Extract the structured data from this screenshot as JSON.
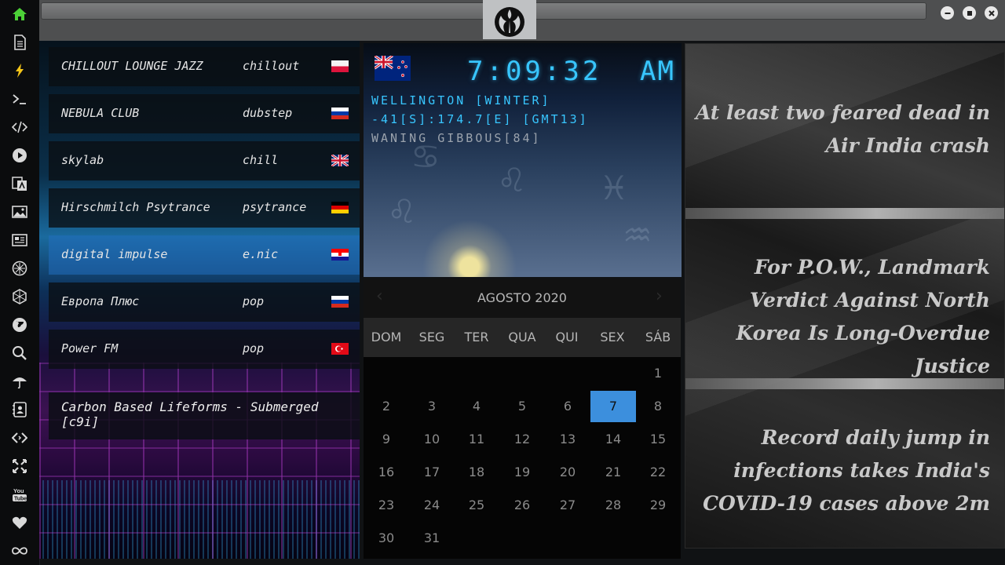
{
  "sidebar": {
    "items": [
      {
        "icon": "home-icon",
        "color": "#4cd137"
      },
      {
        "icon": "document-icon"
      },
      {
        "icon": "lightning-icon",
        "color": "#f5c518"
      },
      {
        "icon": "terminal-icon"
      },
      {
        "icon": "code-icon"
      },
      {
        "icon": "play-icon"
      },
      {
        "icon": "translate-icon"
      },
      {
        "icon": "image-icon"
      },
      {
        "icon": "news-icon"
      },
      {
        "icon": "compass-icon"
      },
      {
        "icon": "hexagon-icon"
      },
      {
        "icon": "globe-icon"
      },
      {
        "icon": "search-icon"
      },
      {
        "icon": "umbrella-icon"
      },
      {
        "icon": "contacts-icon"
      },
      {
        "icon": "code-brackets-icon"
      },
      {
        "icon": "expand-icon"
      },
      {
        "icon": "youtube-icon"
      },
      {
        "icon": "heart-icon"
      },
      {
        "icon": "infinity-icon"
      }
    ]
  },
  "titlebar": {
    "emblem": "rebel-alliance-icon"
  },
  "radio": {
    "stations": [
      {
        "name": "CHILLOUT LOUNGE JAZZ",
        "genre": "chillout",
        "flag": "poland"
      },
      {
        "name": "NEBULA CLUB",
        "genre": "dubstep",
        "flag": "russia"
      },
      {
        "name": "skylab",
        "genre": "chill",
        "flag": "united-kingdom"
      },
      {
        "name": "Hirschmilch Psytrance",
        "genre": "psytrance",
        "flag": "germany"
      },
      {
        "name": "digital impulse",
        "genre": "e.nic",
        "flag": "croatia"
      },
      {
        "name": "Европа Плюс",
        "genre": "pop",
        "flag": "russia"
      },
      {
        "name": "Power FM",
        "genre": "pop",
        "flag": "turkey"
      }
    ],
    "selected_index": 4,
    "now_playing": "Carbon Based Lifeforms - Submerged [c9i]"
  },
  "clock": {
    "flag": "new-zealand",
    "time": "7:09:32",
    "ampm": "AM",
    "city": "WELLINGTON [WINTER]",
    "coords": "-41[S]:174.7[E] [GMT13]",
    "moon": "WANING GIBBOUS[84]"
  },
  "calendar": {
    "month": "AGOSTO 2020",
    "prev": "‹",
    "next": "›",
    "weekdays": [
      "DOM",
      "SEG",
      "TER",
      "QUA",
      "QUI",
      "SEX",
      "SÁB"
    ],
    "first_weekday_index": 6,
    "days_in_month": 31,
    "today": 7,
    "accent": "#3c8fdd"
  },
  "news": {
    "items": [
      "At least two feared dead in Air India crash",
      "For P.O.W., Landmark Verdict Against North Korea Is Long-Overdue Justice",
      "Record daily jump in infections takes India's COVID-19 cases above 2m"
    ]
  }
}
